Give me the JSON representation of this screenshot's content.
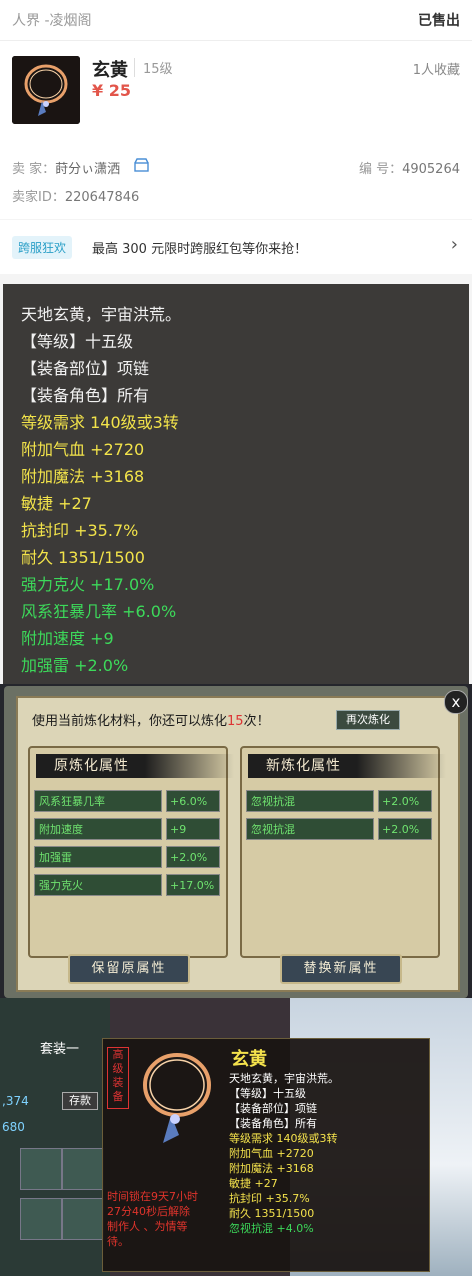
{
  "header": {
    "server": "人界 -凌烟阁",
    "status": "已售出"
  },
  "item": {
    "name": "玄黄",
    "level": "15级",
    "price": "¥ 25",
    "favorites": "1人收藏",
    "seller_label": "卖 家：",
    "seller_name": "莳分ぃ潇洒",
    "serial_label": "编 号：",
    "serial": "4905264",
    "seller_id_label": "卖家ID：",
    "seller_id": "220647846"
  },
  "promo": {
    "tag": "跨服狂欢",
    "text": "最高 300 元限时跨服红包等你来抢！",
    "arrow": "›"
  },
  "stats": [
    {
      "text": "天地玄黄，宇宙洪荒。",
      "color": "w"
    },
    {
      "text": "【等级】十五级",
      "color": "w"
    },
    {
      "text": "【装备部位】项链",
      "color": "w"
    },
    {
      "text": "【装备角色】所有",
      "color": "w"
    },
    {
      "text": "等级需求 140级或3转",
      "color": "y"
    },
    {
      "text": "附加气血 +2720",
      "color": "y"
    },
    {
      "text": "附加魔法 +3168",
      "color": "y"
    },
    {
      "text": "敏捷 +27",
      "color": "y"
    },
    {
      "text": "抗封印 +35.7%",
      "color": "y"
    },
    {
      "text": "耐久 1351/1500",
      "color": "y"
    },
    {
      "text": "强力克火 +17.0%",
      "color": "g"
    },
    {
      "text": "风系狂暴几率 +6.0%",
      "color": "g"
    },
    {
      "text": "附加速度 +9",
      "color": "g"
    },
    {
      "text": "加强雷 +2.0%",
      "color": "g"
    }
  ],
  "refine_dialog": {
    "message_prefix": "使用当前炼化材料，你还可以炼化",
    "count": "15",
    "message_suffix": "次！",
    "again_button": "再次炼化",
    "close": "x",
    "old_title": "原炼化属性",
    "new_title": "新炼化属性",
    "old_props": [
      {
        "name": "风系狂暴几率",
        "value": "+6.0%"
      },
      {
        "name": "附加速度",
        "value": "+9"
      },
      {
        "name": "加强雷",
        "value": "+2.0%"
      },
      {
        "name": "强力克火",
        "value": "+17.0%"
      }
    ],
    "new_props": [
      {
        "name": "忽视抗混",
        "value": "+2.0%"
      },
      {
        "name": "忽视抗混",
        "value": "+2.0%"
      }
    ],
    "keep_button": "保留原属性",
    "replace_button": "替换新属性"
  },
  "game_ui": {
    "suit": "套装一",
    "coord": ",374",
    "deposit": "存款",
    "money": "680"
  },
  "tooltip": {
    "tag": "高级装备",
    "name": "玄黄",
    "lines": [
      {
        "text": "天地玄黄，宇宙洪荒。",
        "color": "#ffffff"
      },
      {
        "text": "【等级】十五级",
        "color": "#ffffff"
      },
      {
        "text": "【装备部位】项链",
        "color": "#ffffff"
      },
      {
        "text": "【装备角色】所有",
        "color": "#ffffff"
      },
      {
        "text": "等级需求 140级或3转",
        "color": "#f4e24c"
      },
      {
        "text": "附加气血 +2720",
        "color": "#f4e24c"
      },
      {
        "text": "附加魔法 +3168",
        "color": "#f4e24c"
      },
      {
        "text": "敏捷 +27",
        "color": "#f4e24c"
      },
      {
        "text": "抗封印 +35.7%",
        "color": "#f4e24c"
      },
      {
        "text": "耐久 1351/1500",
        "color": "#f4e24c"
      },
      {
        "text": "忽视抗混 +4.0%",
        "color": "#3cd95a"
      }
    ],
    "red_lines": [
      "时间锁在9天7小时",
      "27分40秒后解除",
      "制作人 、为情等",
      "待。"
    ]
  },
  "colors": {
    "price": "#e2554a",
    "yellow": "#f2e34a",
    "green": "#3cd95a",
    "panel": "#3c3a38"
  }
}
